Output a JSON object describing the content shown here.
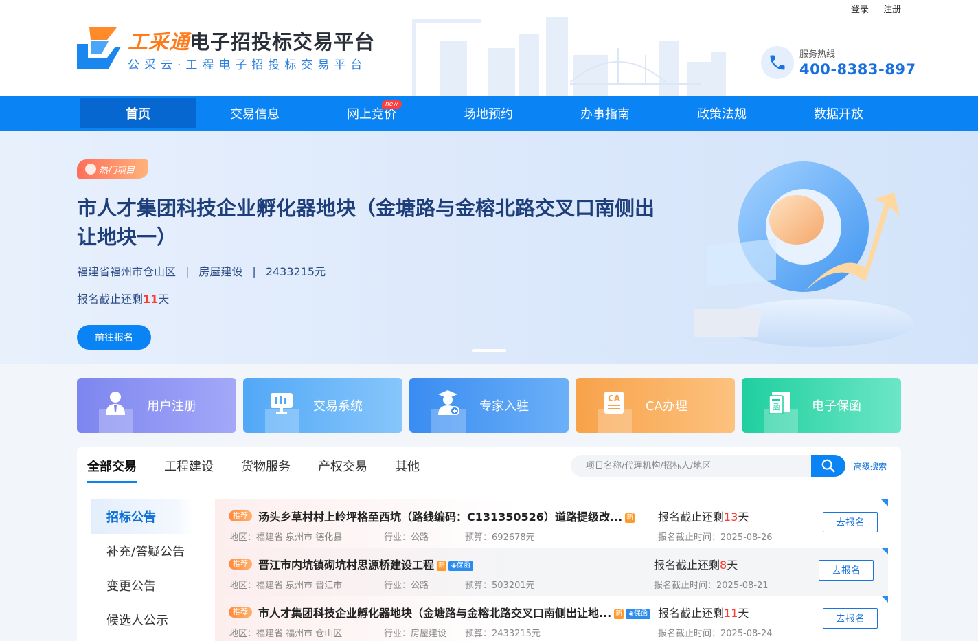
{
  "top_links": {
    "login": "登录",
    "register": "注册"
  },
  "brand": {
    "highlight": "工采通",
    "title_rest": "电子招投标交易平台",
    "subtitle": "公采云·工程电子招投标交易平台"
  },
  "hotline": {
    "label": "服务热线",
    "number": "400-8383-897"
  },
  "nav": {
    "items": [
      {
        "label": "首页"
      },
      {
        "label": "交易信息"
      },
      {
        "label": "网上竞价"
      },
      {
        "label": "场地预约"
      },
      {
        "label": "办事指南"
      },
      {
        "label": "政策法规"
      },
      {
        "label": "数据开放"
      }
    ],
    "new_badge": "new"
  },
  "banner": {
    "tag": "热门项目",
    "title": "市人才集团科技企业孵化器地块（金塘路与金榕北路交叉口南侧出让地块一）",
    "region": "福建省福州市仓山区",
    "industry": "房屋建设",
    "budget": "2433215元",
    "deadline_prefix": "报名截止还剩",
    "deadline_days": "11",
    "deadline_suffix": "天",
    "button": "前往报名",
    "separator": "|"
  },
  "quick_links": [
    {
      "label": "用户注册",
      "icon": "user-icon"
    },
    {
      "label": "交易系统",
      "icon": "chart-monitor-icon"
    },
    {
      "label": "专家入驻",
      "icon": "expert-icon"
    },
    {
      "label": "CA办理",
      "icon": "ca-certificate-icon",
      "icon_text": "CA"
    },
    {
      "label": "电子保函",
      "icon": "guarantee-letter-icon",
      "icon_text": "函"
    }
  ],
  "trade": {
    "tabs": [
      "全部交易",
      "工程建设",
      "货物服务",
      "产权交易",
      "其他"
    ],
    "search_placeholder": "项目名称/代理机构/招标人/地区",
    "advanced_search": "高级搜索",
    "side_items": [
      "招标公告",
      "补充/答疑公告",
      "变更公告",
      "候选人公示"
    ],
    "labels": {
      "recommend": "推荐",
      "new": "新",
      "guarantee": "保函",
      "region": "地区：",
      "industry": "行业：",
      "budget": "预算：",
      "deadline_prefix": "报名截止还剩",
      "deadline_suffix": "天",
      "deadline_time": "报名截止时间：",
      "signup": "去报名"
    },
    "rows": [
      {
        "title": "汤头乡草村村上岭坪格至西坑（路线编码：C131350526）道路提级改...",
        "region": "福建省 泉州市 德化县",
        "industry": "公路",
        "budget": "692678元",
        "days": "13",
        "deadline": "2025-08-26"
      },
      {
        "title": "晋江市内坑镇砌坑村思源桥建设工程",
        "region": "福建省 泉州市 晋江市",
        "industry": "公路",
        "budget": "503201元",
        "days": "8",
        "deadline": "2025-08-21"
      },
      {
        "title": "市人才集团科技企业孵化器地块（金塘路与金榕北路交叉口南侧出让地...",
        "region": "福建省 福州市 仓山区",
        "industry": "房屋建设",
        "budget": "2433215元",
        "days": "11",
        "deadline": "2025-08-24"
      }
    ]
  },
  "colors": {
    "primary": "#0a84f4",
    "accent_orange": "#ff7a1a",
    "deadline_red": "#ff3b30"
  }
}
